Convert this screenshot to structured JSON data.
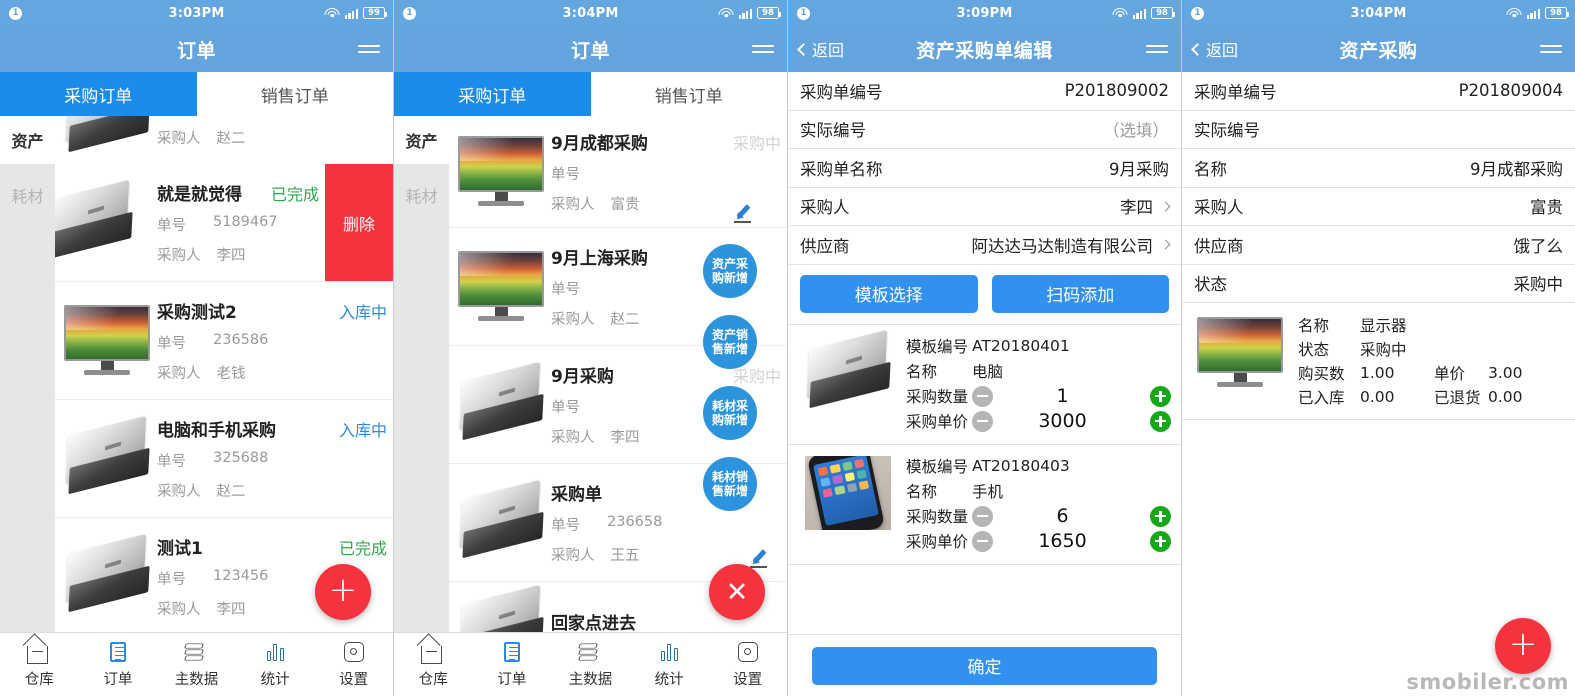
{
  "panels": {
    "p1": {
      "status": {
        "badge": "1",
        "time": "3:03PM",
        "battery": "99"
      },
      "nav": {
        "title": "订单",
        "menu_icon": "hamburger-icon"
      },
      "tabs": [
        {
          "label": "采购订单",
          "active": true
        },
        {
          "label": "销售订单",
          "active": false
        }
      ],
      "rail": [
        {
          "label": "资产",
          "active": true
        },
        {
          "label": "耗材",
          "active": false
        }
      ],
      "partial_row": {
        "key": "采购人",
        "value": "赵二"
      },
      "rows": [
        {
          "title": "就是就觉得",
          "status": "已完成",
          "status_type": "done",
          "order_key": "单号",
          "order_no": "5189467",
          "buyer_key": "采购人",
          "buyer": "李四",
          "thumb": "laptop-image",
          "delete_label": "删除"
        },
        {
          "title": "采购测试2",
          "status": "入库中",
          "status_type": "in",
          "order_key": "单号",
          "order_no": "236586",
          "buyer_key": "采购人",
          "buyer": "老钱",
          "thumb": "monitor-image"
        },
        {
          "title": "电脑和手机采购",
          "status": "入库中",
          "status_type": "in",
          "order_key": "单号",
          "order_no": "325688",
          "buyer_key": "采购人",
          "buyer": "赵二",
          "thumb": "laptop-image"
        },
        {
          "title": "测试1",
          "status": "已完成",
          "status_type": "done",
          "order_key": "单号",
          "order_no": "123456",
          "buyer_key": "采购人",
          "buyer": "李四",
          "thumb": "laptop-image"
        }
      ],
      "fab": {
        "icon": "plus-icon",
        "color": "#f5333f"
      },
      "tabbar": [
        {
          "label": "仓库",
          "icon": "warehouse-icon",
          "active": false
        },
        {
          "label": "订单",
          "icon": "order-icon",
          "active": true
        },
        {
          "label": "主数据",
          "icon": "layers-icon",
          "active": false
        },
        {
          "label": "统计",
          "icon": "chart-icon",
          "active": false
        },
        {
          "label": "设置",
          "icon": "gear-icon",
          "active": false
        }
      ]
    },
    "p2": {
      "status": {
        "badge": "1",
        "time": "3:04PM",
        "battery": "98"
      },
      "nav": {
        "title": "订单",
        "menu_icon": "hamburger-icon"
      },
      "tabs": [
        {
          "label": "采购订单",
          "active": true
        },
        {
          "label": "销售订单",
          "active": false
        }
      ],
      "rail": [
        {
          "label": "资产",
          "active": true
        },
        {
          "label": "耗材",
          "active": false
        }
      ],
      "rows": [
        {
          "title": "9月成都采购",
          "status": "采购中",
          "status_type": "ing",
          "order_key": "单号",
          "order_no": "",
          "buyer_key": "采购人",
          "buyer": "富贵",
          "thumb": "monitor-image"
        },
        {
          "title": "9月上海采购",
          "status": "",
          "status_type": "ing",
          "order_key": "单号",
          "order_no": "",
          "buyer_key": "采购人",
          "buyer": "赵二",
          "thumb": "monitor-image"
        },
        {
          "title": "9月采购",
          "status": "采购中",
          "status_type": "ing",
          "order_key": "单号",
          "order_no": "",
          "buyer_key": "采购人",
          "buyer": "李四",
          "thumb": "laptop-image"
        },
        {
          "title": "采购单",
          "status": "",
          "status_type": "ing",
          "order_key": "单号",
          "order_no": "236658",
          "buyer_key": "采购人",
          "buyer": "王五",
          "thumb": "laptop-image"
        },
        {
          "title": "回家点进去",
          "status": "",
          "status_type": "ing",
          "order_key": "",
          "order_no": "",
          "buyer_key": "",
          "buyer": "",
          "thumb": "laptop-image"
        }
      ],
      "fab_menu": [
        {
          "label": "资产采购新增"
        },
        {
          "label": "资产销售新增"
        },
        {
          "label": "耗材采购新增"
        },
        {
          "label": "耗材销售新增"
        }
      ],
      "edit_icon": "pencil-icon",
      "fab": {
        "icon": "close-icon",
        "color": "#f5333f"
      },
      "tabbar": [
        {
          "label": "仓库",
          "icon": "warehouse-icon",
          "active": false
        },
        {
          "label": "订单",
          "icon": "order-icon",
          "active": true
        },
        {
          "label": "主数据",
          "icon": "layers-icon",
          "active": false
        },
        {
          "label": "统计",
          "icon": "chart-icon",
          "active": false
        },
        {
          "label": "设置",
          "icon": "gear-icon",
          "active": false
        }
      ]
    },
    "p3": {
      "status": {
        "badge": "1",
        "time": "3:09PM",
        "battery": "98"
      },
      "nav": {
        "back_label": "返回",
        "title": "资产采购单编辑",
        "menu_icon": "hamburger-icon"
      },
      "form": [
        {
          "label": "采购单编号",
          "value": "P201809002",
          "chevron": false,
          "placeholder": false
        },
        {
          "label": "实际编号",
          "value": "（选填）",
          "chevron": false,
          "placeholder": true
        },
        {
          "label": "采购单名称",
          "value": "9月采购",
          "chevron": false,
          "placeholder": false
        },
        {
          "label": "采购人",
          "value": "李四",
          "chevron": true,
          "placeholder": false
        },
        {
          "label": "供应商",
          "value": "阿达达马达制造有限公司",
          "chevron": true,
          "placeholder": false
        }
      ],
      "buttons": [
        {
          "label": "模板选择"
        },
        {
          "label": "扫码添加"
        }
      ],
      "products": [
        {
          "code_key": "模板编号",
          "code": "AT20180401",
          "name_key": "名称",
          "name": "电脑",
          "qty_key": "采购数量",
          "qty": "1",
          "price_key": "采购单价",
          "price": "3000",
          "thumb": "laptop-image"
        },
        {
          "code_key": "模板编号",
          "code": "AT20180403",
          "name_key": "名称",
          "name": "手机",
          "qty_key": "采购数量",
          "qty": "6",
          "price_key": "采购单价",
          "price": "1650",
          "thumb": "phone-image"
        }
      ],
      "confirm": "确定"
    },
    "p4": {
      "status": {
        "badge": "1",
        "time": "3:04PM",
        "battery": "98"
      },
      "nav": {
        "back_label": "返回",
        "title": "资产采购",
        "menu_icon": "hamburger-icon"
      },
      "form": [
        {
          "label": "采购单编号",
          "value": "P201809004"
        },
        {
          "label": "实际编号",
          "value": ""
        },
        {
          "label": "名称",
          "value": "9月成都采购"
        },
        {
          "label": "采购人",
          "value": "富贵"
        },
        {
          "label": "供应商",
          "value": "饿了么"
        },
        {
          "label": "状态",
          "value": "采购中"
        }
      ],
      "detail": {
        "thumb": "monitor-image",
        "lines": [
          {
            "k1": "名称",
            "v1": "显示器",
            "k2": "",
            "v2": ""
          },
          {
            "k1": "状态",
            "v1": "采购中",
            "k2": "",
            "v2": ""
          },
          {
            "k1": "购买数",
            "v1": "1.00",
            "k2": "单价",
            "v2": "3.00"
          },
          {
            "k1": "已入库",
            "v1": "0.00",
            "k2": "已退货",
            "v2": "0.00"
          }
        ]
      },
      "fab": {
        "icon": "plus-icon",
        "color": "#f5333f"
      },
      "watermark": "smobiler.com"
    }
  }
}
